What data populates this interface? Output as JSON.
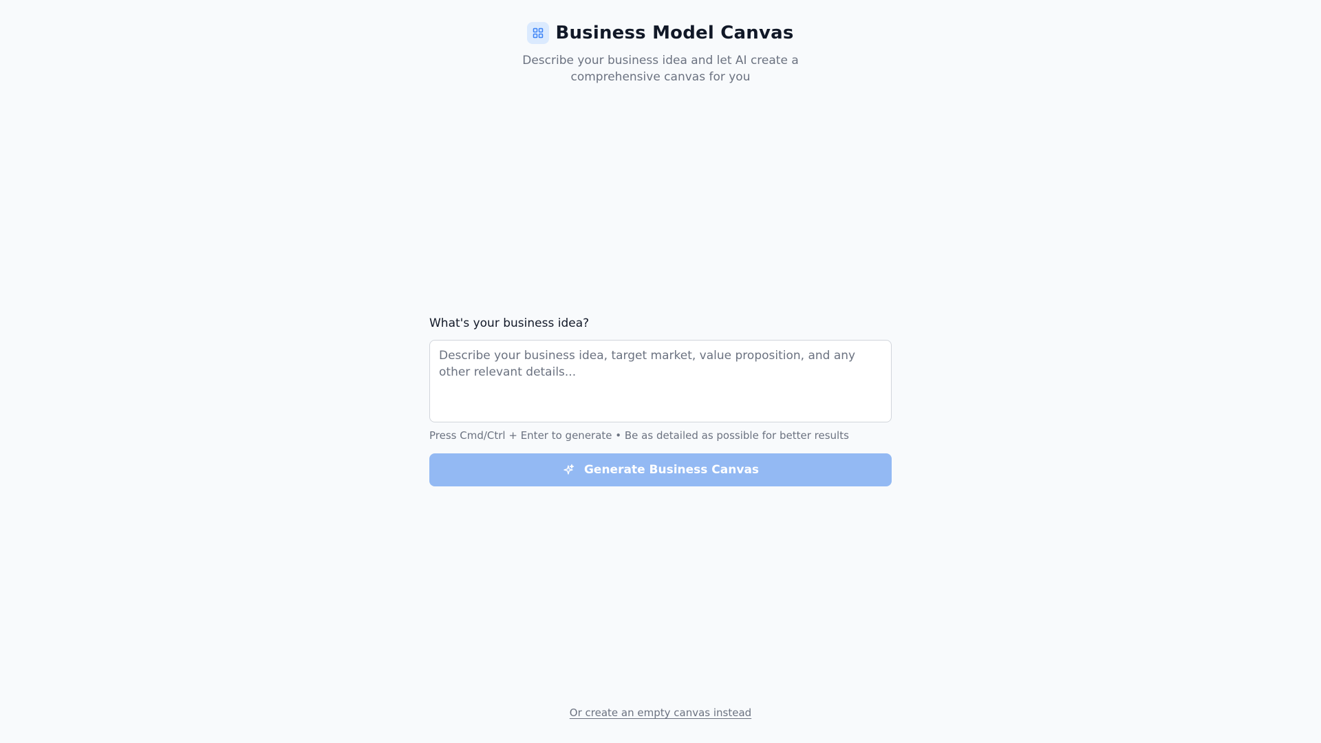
{
  "header": {
    "title": "Business Model Canvas",
    "subtitle": "Describe your business idea and let AI create a comprehensive canvas for you",
    "logo_icon": "grid-icon"
  },
  "form": {
    "label": "What's your business idea?",
    "textarea": {
      "value": "",
      "placeholder": "Describe your business idea, target market, value proposition, and any other relevant details..."
    },
    "hint": "Press Cmd/Ctrl + Enter to generate • Be as detailed as possible for better results",
    "generate_button": {
      "label": "Generate Business Canvas",
      "icon": "sparkles-icon",
      "disabled": true
    }
  },
  "footer": {
    "empty_canvas_link": "Or create an empty canvas instead"
  },
  "colors": {
    "background": "#f8fafc",
    "accent": "#3b82f6",
    "button_disabled": "#93b9f3",
    "muted_text": "#6b7280"
  }
}
